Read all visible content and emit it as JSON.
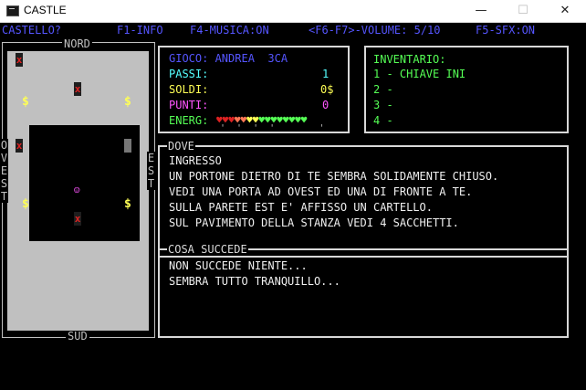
{
  "window": {
    "title": "CASTLE"
  },
  "menubar": {
    "location": "CASTELLO?",
    "info": "F1-INFO",
    "music": "F4-MUSICA:ON",
    "volume": "<F6-F7>-VOLUME: 5/10",
    "sfx": "F5-SFX:ON"
  },
  "map": {
    "north_label": "NORD",
    "south_label": "SUD",
    "west_letters": [
      "O",
      "V",
      "E",
      "S",
      "T"
    ],
    "east_letters": [
      "E",
      "S",
      "T"
    ]
  },
  "stats": {
    "header": "GIOCO: ANDREA  3CA",
    "rows": [
      {
        "label": "PASSI:",
        "value": "1",
        "color": "#55ffff"
      },
      {
        "label": "SOLDI:",
        "value": "0$",
        "color": "#ffff55"
      },
      {
        "label": "PUNTI:",
        "value": "0",
        "color": "#ff55ff"
      }
    ],
    "energy_label": "ENERG:",
    "energy_hearts": "♥♥♥♥♥♥♥♥♥♥♥♥♥♥♥",
    "energy_ticks": "'  '  '  '        '"
  },
  "inventory": {
    "title": "INVENTARIO:",
    "items": [
      "1 - CHIAVE INI",
      "2 -",
      "3 -",
      "4 -"
    ]
  },
  "dove": {
    "label": "DOVE",
    "lines": [
      "INGRESSO",
      "UN PORTONE DIETRO DI TE SEMBRA SOLIDAMENTE CHIUSO.",
      "VEDI UNA PORTA AD OVEST ED UNA DI FRONTE A TE.",
      "SULLA PARETE EST E' AFFISSO UN CARTELLO.",
      "SUL PAVIMENTO DELLA STANZA VEDI 4 SACCHETTI."
    ]
  },
  "succede": {
    "label": "COSA SUCCEDE",
    "lines": [
      "NON SUCCEDE NIENTE...",
      "SEMBRA TUTTO TRANQUILLO..."
    ]
  },
  "colors": {
    "menu": "#5555ff",
    "green": "#55ff55",
    "yellow": "#ffff55",
    "magenta": "#ff55ff",
    "cyan": "#55ffff"
  }
}
